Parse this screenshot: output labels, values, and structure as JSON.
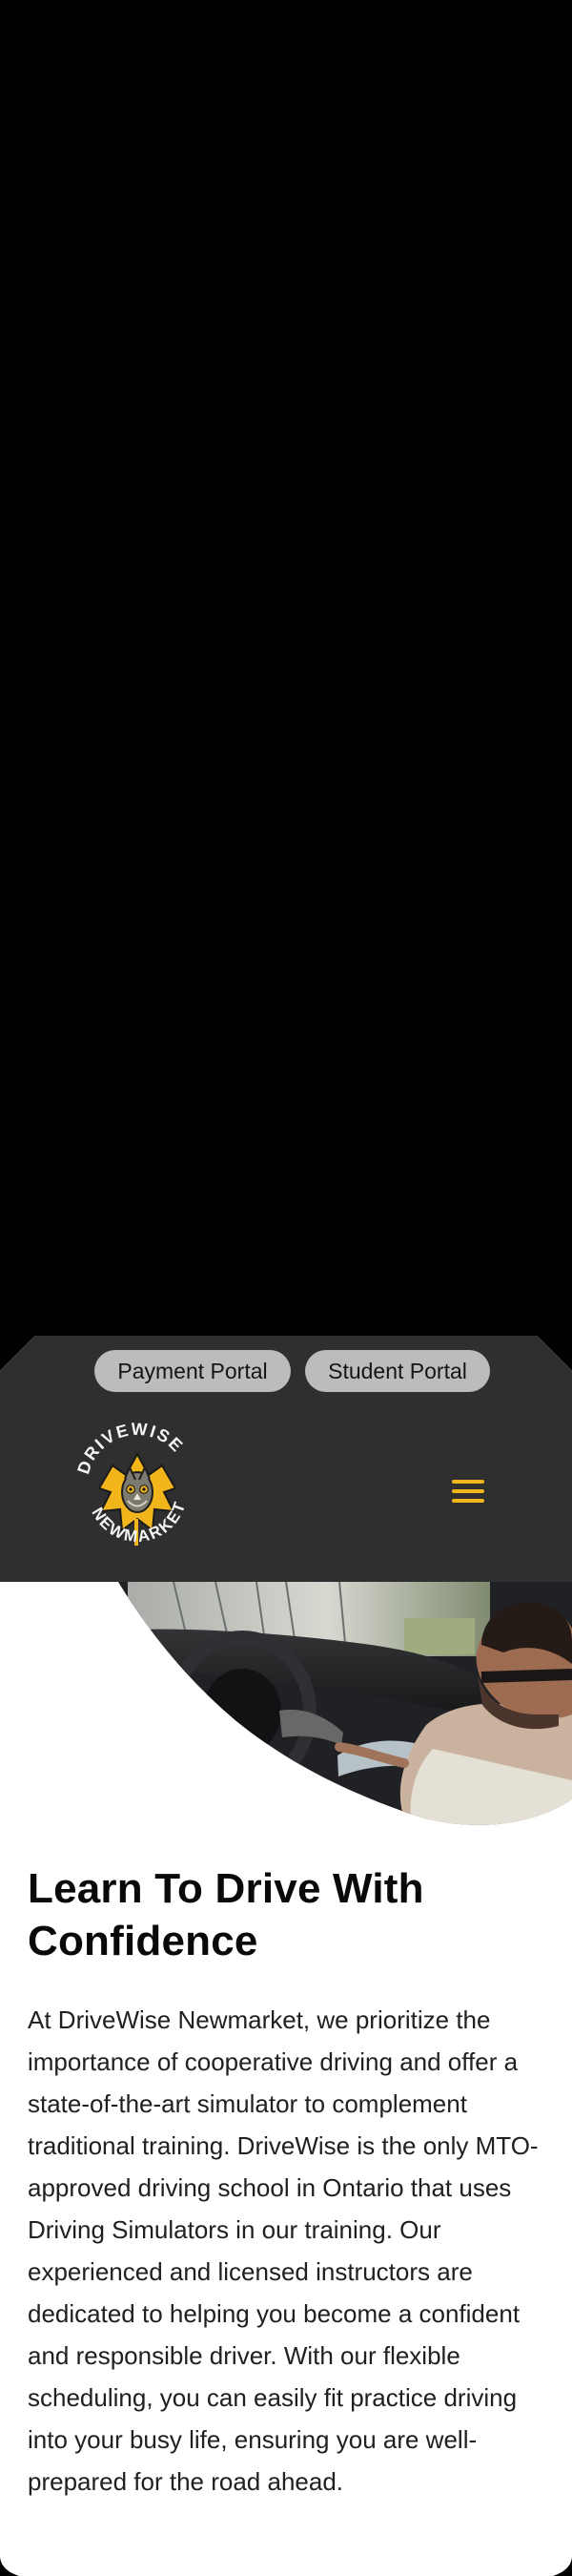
{
  "portals": {
    "payment_label": "Payment Portal",
    "student_label": "Student Portal"
  },
  "logo": {
    "top_text": "DRIVEWISE",
    "bottom_text": "NEWMARKET"
  },
  "menu": {
    "icon": "hamburger-menu-icon"
  },
  "hero": {
    "image": "driving-lesson-photo"
  },
  "content": {
    "title": "Learn To Drive With Confidence",
    "paragraph": "At DriveWise Newmarket, we prioritize the importance of cooperative driving and offer a state-of-the-art simulator to complement traditional training. DriveWise is the only MTO-approved driving school in Ontario that uses Driving Simulators in our training. Our experienced and licensed instructors are dedicated to helping you become a confident and responsible driver. With our flexible scheduling, you can easily fit practice driving into your busy life, ensuring you are well-prepared for the road ahead."
  },
  "colors": {
    "background": "#000000",
    "header": "#2f2f2f",
    "button": "#bcbcbc",
    "accent": "#f2b51b",
    "content": "#ffffff",
    "text": "#202020"
  }
}
